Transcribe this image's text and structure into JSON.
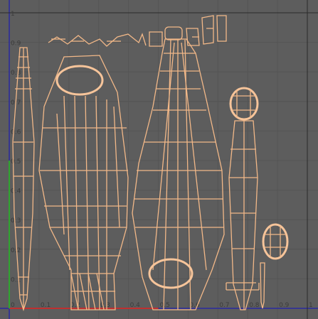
{
  "uv_editor": {
    "x_axis_labels": [
      "0",
      "0.1",
      "0.2",
      "0.3",
      "0.4",
      "0.5",
      "0.6",
      "0.7",
      "0.8",
      "0.9",
      "1"
    ],
    "y_axis_labels": [
      "0",
      "0.1",
      "0.2",
      "0.3",
      "0.4",
      "0.5",
      "0.6",
      "0.7",
      "0.8",
      "0.9",
      "1"
    ],
    "colors": {
      "background": "#5d5d5d",
      "grid": "#555555",
      "u_axis": "#c03030",
      "v_axis": "#2fa52f",
      "uv_border": "#2a2aa0",
      "wireframe": "#f2b888"
    }
  }
}
